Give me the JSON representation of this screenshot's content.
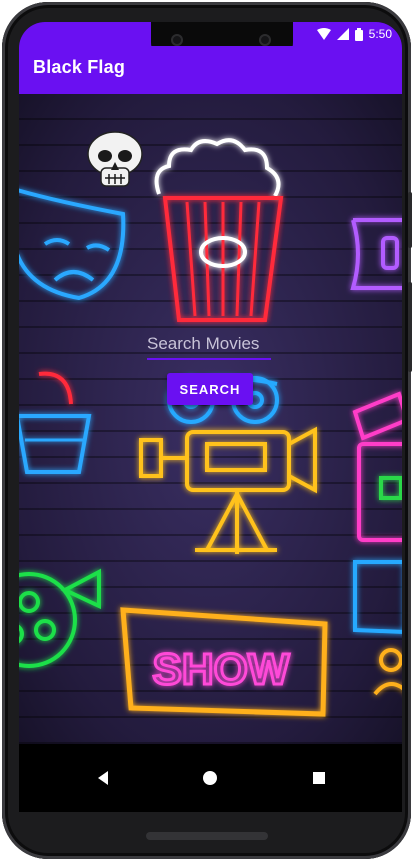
{
  "status_bar": {
    "time": "5:50",
    "icons": [
      "wifi-icon",
      "cell-signal-icon",
      "battery-icon"
    ]
  },
  "app_bar": {
    "title": "Black Flag",
    "color": "#6a10f2"
  },
  "search": {
    "placeholder": "Search Movies",
    "value": "",
    "button_label": "SEARCH"
  },
  "background": {
    "neon_sign_text": "SHOW",
    "icons": [
      "skull-icon",
      "drama-mask-icon",
      "popcorn-icon",
      "ticket-icon",
      "3d-glasses-icon",
      "film-camera-icon",
      "popcorn-bucket-icon",
      "clapperboard-icon",
      "film-reel-icon",
      "show-sign-icon"
    ]
  },
  "nav": {
    "buttons": [
      "back-icon",
      "home-icon",
      "recents-icon"
    ]
  }
}
